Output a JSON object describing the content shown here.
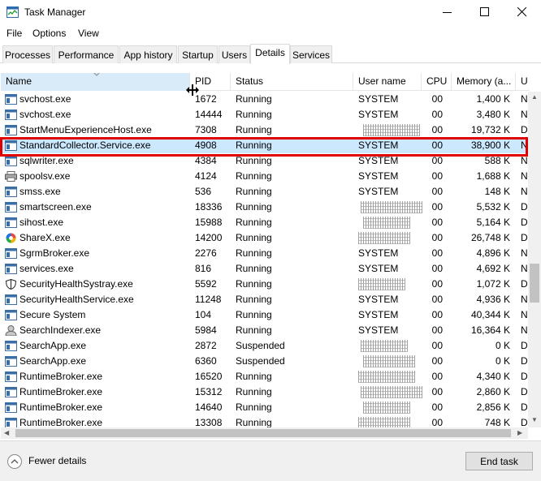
{
  "window": {
    "title": "Task Manager"
  },
  "menu": [
    "File",
    "Options",
    "View"
  ],
  "tabs": [
    "Processes",
    "Performance",
    "App history",
    "Startup",
    "Users",
    "Details",
    "Services"
  ],
  "active_tab": "Details",
  "columns": [
    "Name",
    "PID",
    "Status",
    "User name",
    "CPU",
    "Memory (a...",
    "U"
  ],
  "sorted_column": "Name",
  "rows": [
    {
      "name": "svchost.exe",
      "pid": "1672",
      "status": "Running",
      "user": "SYSTEM",
      "cpu": "00",
      "mem": "1,400 K",
      "u": "N",
      "icon": "service-icon"
    },
    {
      "name": "svchost.exe",
      "pid": "14444",
      "status": "Running",
      "user": "SYSTEM",
      "cpu": "00",
      "mem": "3,480 K",
      "u": "N",
      "icon": "service-icon"
    },
    {
      "name": "StartMenuExperienceHost.exe",
      "pid": "7308",
      "status": "Running",
      "user": "",
      "cpu": "00",
      "mem": "19,732 K",
      "u": "D",
      "icon": "service-icon"
    },
    {
      "name": "StandardCollector.Service.exe",
      "pid": "4908",
      "status": "Running",
      "user": "SYSTEM",
      "cpu": "00",
      "mem": "38,900 K",
      "u": "N",
      "icon": "service-icon"
    },
    {
      "name": "sqlwriter.exe",
      "pid": "4384",
      "status": "Running",
      "user": "SYSTEM",
      "cpu": "00",
      "mem": "588 K",
      "u": "N",
      "icon": "service-icon"
    },
    {
      "name": "spoolsv.exe",
      "pid": "4124",
      "status": "Running",
      "user": "SYSTEM",
      "cpu": "00",
      "mem": "1,688 K",
      "u": "N",
      "icon": "printer-icon"
    },
    {
      "name": "smss.exe",
      "pid": "536",
      "status": "Running",
      "user": "SYSTEM",
      "cpu": "00",
      "mem": "148 K",
      "u": "N",
      "icon": "service-icon"
    },
    {
      "name": "smartscreen.exe",
      "pid": "18336",
      "status": "Running",
      "user": "",
      "cpu": "00",
      "mem": "5,532 K",
      "u": "D",
      "icon": "service-icon"
    },
    {
      "name": "sihost.exe",
      "pid": "15988",
      "status": "Running",
      "user": "",
      "cpu": "00",
      "mem": "5,164 K",
      "u": "D",
      "icon": "service-icon"
    },
    {
      "name": "ShareX.exe",
      "pid": "14200",
      "status": "Running",
      "user": "",
      "cpu": "00",
      "mem": "26,748 K",
      "u": "D",
      "icon": "sharex-icon"
    },
    {
      "name": "SgrmBroker.exe",
      "pid": "2276",
      "status": "Running",
      "user": "SYSTEM",
      "cpu": "00",
      "mem": "4,896 K",
      "u": "N",
      "icon": "service-icon"
    },
    {
      "name": "services.exe",
      "pid": "816",
      "status": "Running",
      "user": "SYSTEM",
      "cpu": "00",
      "mem": "4,692 K",
      "u": "N",
      "icon": "service-icon"
    },
    {
      "name": "SecurityHealthSystray.exe",
      "pid": "5592",
      "status": "Running",
      "user": "",
      "cpu": "00",
      "mem": "1,072 K",
      "u": "D",
      "icon": "shield-icon"
    },
    {
      "name": "SecurityHealthService.exe",
      "pid": "11248",
      "status": "Running",
      "user": "SYSTEM",
      "cpu": "00",
      "mem": "4,936 K",
      "u": "N",
      "icon": "service-icon"
    },
    {
      "name": "Secure System",
      "pid": "104",
      "status": "Running",
      "user": "SYSTEM",
      "cpu": "00",
      "mem": "40,344 K",
      "u": "N",
      "icon": "service-icon"
    },
    {
      "name": "SearchIndexer.exe",
      "pid": "5984",
      "status": "Running",
      "user": "SYSTEM",
      "cpu": "00",
      "mem": "16,364 K",
      "u": "N",
      "icon": "search-indexer-icon"
    },
    {
      "name": "SearchApp.exe",
      "pid": "2872",
      "status": "Suspended",
      "user": "",
      "cpu": "00",
      "mem": "0 K",
      "u": "D",
      "icon": "service-icon"
    },
    {
      "name": "SearchApp.exe",
      "pid": "6360",
      "status": "Suspended",
      "user": "",
      "cpu": "00",
      "mem": "0 K",
      "u": "D",
      "icon": "service-icon"
    },
    {
      "name": "RuntimeBroker.exe",
      "pid": "16520",
      "status": "Running",
      "user": "",
      "cpu": "00",
      "mem": "4,340 K",
      "u": "D",
      "icon": "service-icon"
    },
    {
      "name": "RuntimeBroker.exe",
      "pid": "15312",
      "status": "Running",
      "user": "",
      "cpu": "00",
      "mem": "2,860 K",
      "u": "D",
      "icon": "service-icon"
    },
    {
      "name": "RuntimeBroker.exe",
      "pid": "14640",
      "status": "Running",
      "user": "",
      "cpu": "00",
      "mem": "2,856 K",
      "u": "D",
      "icon": "service-icon"
    },
    {
      "name": "RuntimeBroker.exe",
      "pid": "13308",
      "status": "Running",
      "user": "",
      "cpu": "00",
      "mem": "748 K",
      "u": "D",
      "icon": "service-icon"
    }
  ],
  "selected_row": "StandardCollector.Service.exe",
  "footer": {
    "fewer_details": "Fewer details",
    "end_task": "End task"
  },
  "colors": {
    "highlight": "#e00000",
    "selection": "#cce8ff",
    "sorted_header": "#d9ebf9"
  }
}
